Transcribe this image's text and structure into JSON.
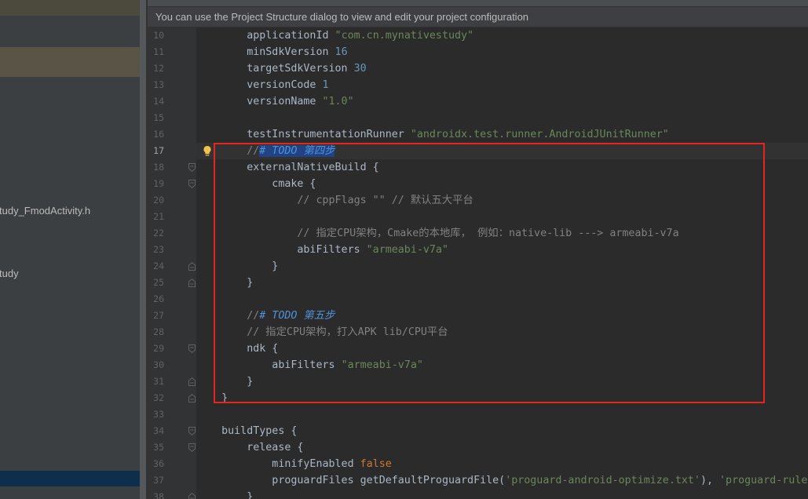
{
  "project_panel": {
    "items": [
      {
        "label": "tudy_FmodActivity.h"
      },
      {
        "label": "tudy"
      }
    ]
  },
  "notification": {
    "text": "You can use the Project Structure dialog to view and edit your project configuration"
  },
  "editor": {
    "text_color": "#a9b7c6",
    "selection_color": "#214283",
    "current_line_color": "#323232",
    "lines": [
      {
        "num": "10",
        "tokens": [
          {
            "text": "        applicationId "
          },
          {
            "text": "\"com.cn.mynativestudy\"",
            "color": "#6a8759"
          }
        ]
      },
      {
        "num": "11",
        "tokens": [
          {
            "text": "        minSdkVersion "
          },
          {
            "text": "16",
            "color": "#6897bb"
          }
        ]
      },
      {
        "num": "12",
        "tokens": [
          {
            "text": "        targetSdkVersion "
          },
          {
            "text": "30",
            "color": "#6897bb"
          }
        ]
      },
      {
        "num": "13",
        "tokens": [
          {
            "text": "        versionCode "
          },
          {
            "text": "1",
            "color": "#6897bb"
          }
        ]
      },
      {
        "num": "14",
        "tokens": [
          {
            "text": "        versionName "
          },
          {
            "text": "\"1.0\"",
            "color": "#6a8759"
          }
        ]
      },
      {
        "num": "15",
        "tokens": []
      },
      {
        "num": "16",
        "tokens": [
          {
            "text": "        testInstrumentationRunner "
          },
          {
            "text": "\"androidx.test.runner.AndroidJUnitRunner\"",
            "color": "#6a8759"
          }
        ]
      },
      {
        "num": "17",
        "current": true,
        "bulb_icon": "lightbulb-icon",
        "tokens": [
          {
            "text": "        //",
            "color": "#808080"
          },
          {
            "text": "# TODO 第四步",
            "color": "#4f93d8",
            "italic": true,
            "selected": true
          }
        ]
      },
      {
        "num": "18",
        "fold_icon": "fold-collapse-icon",
        "tokens": [
          {
            "text": "        externalNativeBuild {"
          }
        ]
      },
      {
        "num": "19",
        "fold_icon": "fold-collapse-icon",
        "tokens": [
          {
            "text": "            cmake {"
          }
        ]
      },
      {
        "num": "20",
        "tokens": [
          {
            "text": "                // cppFlags \"\" // 默认五大平台",
            "color": "#808080"
          }
        ]
      },
      {
        "num": "21",
        "tokens": []
      },
      {
        "num": "22",
        "tokens": [
          {
            "text": "                // 指定CPU架构，Cmake的本地库， 例如：native-lib ---> armeabi-v7a",
            "color": "#808080"
          }
        ]
      },
      {
        "num": "23",
        "tokens": [
          {
            "text": "                abiFilters "
          },
          {
            "text": "\"armeabi-v7a\"",
            "color": "#6a8759"
          }
        ]
      },
      {
        "num": "24",
        "fold_icon": "fold-end-icon",
        "tokens": [
          {
            "text": "            }"
          }
        ]
      },
      {
        "num": "25",
        "fold_icon": "fold-end-icon",
        "tokens": [
          {
            "text": "        }"
          }
        ]
      },
      {
        "num": "26",
        "tokens": []
      },
      {
        "num": "27",
        "tokens": [
          {
            "text": "        //",
            "color": "#808080"
          },
          {
            "text": "# TODO 第五步",
            "color": "#4f93d8",
            "italic": true
          }
        ]
      },
      {
        "num": "28",
        "tokens": [
          {
            "text": "        // 指定CPU架构，打入APK lib/CPU平台",
            "color": "#808080"
          }
        ]
      },
      {
        "num": "29",
        "fold_icon": "fold-collapse-icon",
        "tokens": [
          {
            "text": "        ndk {"
          }
        ]
      },
      {
        "num": "30",
        "tokens": [
          {
            "text": "            abiFilters "
          },
          {
            "text": "\"armeabi-v7a\"",
            "color": "#6a8759"
          }
        ]
      },
      {
        "num": "31",
        "fold_icon": "fold-end-icon",
        "tokens": [
          {
            "text": "        }"
          }
        ]
      },
      {
        "num": "32",
        "fold_icon": "fold-end-icon",
        "tokens": [
          {
            "text": "    }"
          }
        ]
      },
      {
        "num": "33",
        "tokens": []
      },
      {
        "num": "34",
        "fold_icon": "fold-collapse-icon",
        "tokens": [
          {
            "text": "    buildTypes {"
          }
        ]
      },
      {
        "num": "35",
        "fold_icon": "fold-collapse-icon",
        "tokens": [
          {
            "text": "        release {"
          }
        ]
      },
      {
        "num": "36",
        "tokens": [
          {
            "text": "            minifyEnabled "
          },
          {
            "text": "false",
            "color": "#cc7832"
          }
        ]
      },
      {
        "num": "37",
        "tokens": [
          {
            "text": "            proguardFiles getDefaultProguardFile("
          },
          {
            "text": "'proguard-android-optimize.txt'",
            "color": "#6a8759"
          },
          {
            "text": "), "
          },
          {
            "text": "'proguard-rules",
            "color": "#6a8759"
          }
        ]
      },
      {
        "num": "38",
        "fold_icon": "fold-end-icon",
        "tokens": [
          {
            "text": "        }"
          }
        ]
      }
    ]
  },
  "annotation": {
    "color": "#e8241f",
    "first_line": 17,
    "last_line": 32
  }
}
